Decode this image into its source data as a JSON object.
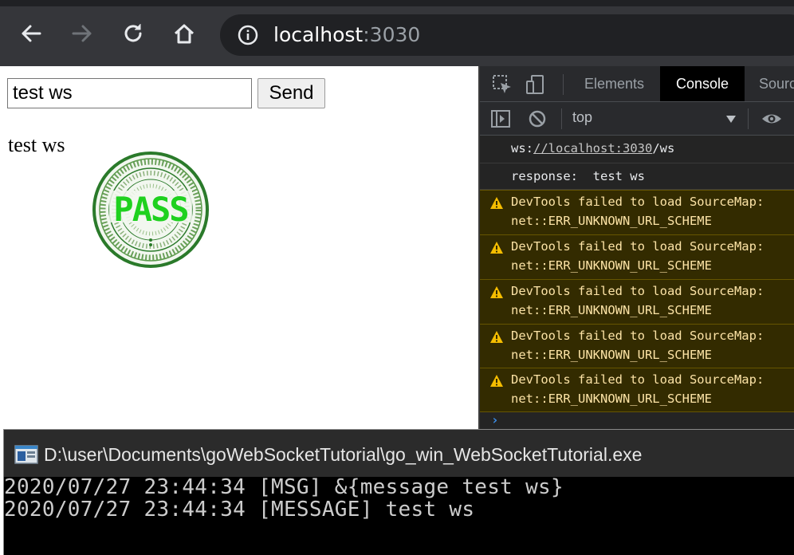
{
  "browser": {
    "url_host": "localhost",
    "url_port": ":3030"
  },
  "page": {
    "input_value": "test ws",
    "send_label": "Send",
    "echo_text": "test ws",
    "stamp_text": "PASS"
  },
  "devtools": {
    "tabs": [
      {
        "label": "Elements",
        "active": false
      },
      {
        "label": "Console",
        "active": true
      },
      {
        "label": "Sourc",
        "active": false
      }
    ],
    "context": "top",
    "logs": [
      {
        "prefix": "ws:",
        "link": "//localhost:3030",
        "suffix": "/ws"
      },
      {
        "text": "response:  test ws"
      }
    ],
    "warnings": [
      {
        "line1": "DevTools failed to load SourceMap:",
        "line2": "net::ERR_UNKNOWN_URL_SCHEME"
      },
      {
        "line1": "DevTools failed to load SourceMap:",
        "line2": "net::ERR_UNKNOWN_URL_SCHEME"
      },
      {
        "line1": "DevTools failed to load SourceMap:",
        "line2": "net::ERR_UNKNOWN_URL_SCHEME"
      },
      {
        "line1": "DevTools failed to load SourceMap:",
        "line2": "net::ERR_UNKNOWN_URL_SCHEME"
      },
      {
        "line1": "DevTools failed to load SourceMap:",
        "line2": "net::ERR_UNKNOWN_URL_SCHEME"
      }
    ],
    "prompt": "›"
  },
  "terminal": {
    "title": "D:\\user\\Documents\\goWebSocketTutorial\\go_win_WebSocketTutorial.exe",
    "lines": [
      "2020/07/27 23:44:34 [MSG] &{message test ws}",
      "2020/07/27 23:44:34 [MESSAGE] test ws"
    ]
  },
  "colors": {
    "warning_bg": "#332b00",
    "warning_text": "#fce3a6",
    "stamp_green": "#2a7a2a",
    "pass_green": "#1fd11f"
  }
}
